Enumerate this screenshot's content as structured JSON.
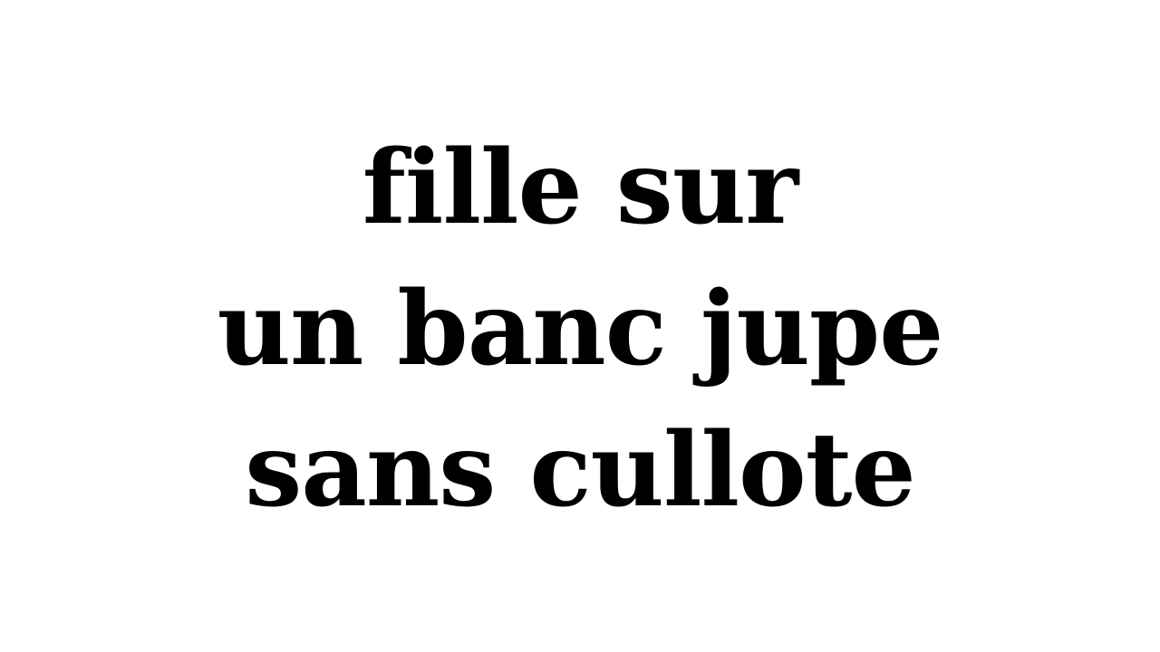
{
  "lines": [
    "fille sur",
    "un banc jupe",
    "sans cullote"
  ],
  "colors": {
    "background": "#ffffff",
    "text": "#000000"
  }
}
